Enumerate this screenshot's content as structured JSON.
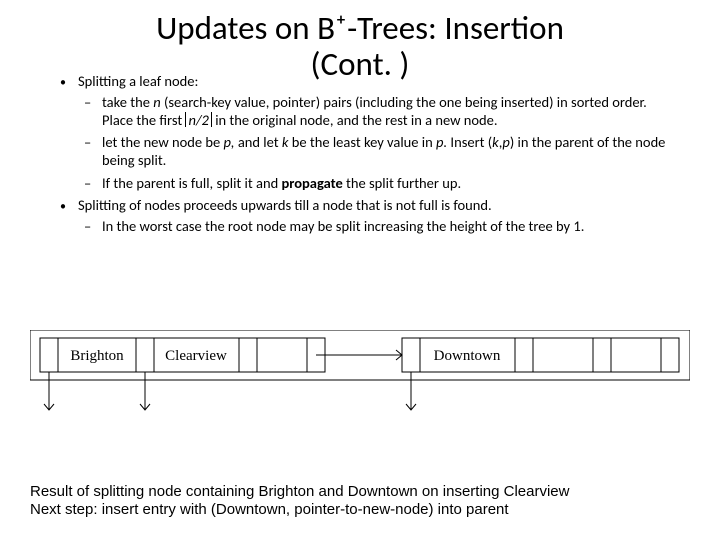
{
  "title_l1": "Updates on B⁺-Trees:  Insertion",
  "title_l2": "(Cont. )",
  "b1": "Splitting a leaf node:",
  "b1a_pre": "take the ",
  "b1a_n": "n",
  "b1a_mid": " (search-key value, pointer) pairs (including the one being inserted) in sorted order.  Place the first ",
  "b1a_ceil": "n/2",
  "b1a_post": " in the original node, and the rest in a new node.",
  "b1b_pre": "let the new node be ",
  "b1b_p": "p,",
  "b1b_mid1": " and let ",
  "b1b_k": "k",
  "b1b_mid2": " be the least key value in ",
  "b1b_p2": "p.",
  "b1b_mid3": "  Insert (",
  "b1b_k2": "k",
  "b1b_comma": ",",
  "b1b_p3": "p",
  "b1b_post": ") in the parent of the node being split.",
  "b1c_pre": "If the parent is full, split it and ",
  "b1c_bold": "propagate",
  "b1c_post": " the split further up.",
  "b2": "Splitting of nodes proceeds upwards till a node that is not full is found.",
  "b2a": "In the worst case the root node may be split increasing the height of the tree by 1.",
  "diagram": {
    "cells": [
      "Brighton",
      "Clearview",
      "",
      "Downtown",
      ""
    ]
  },
  "caption_l1": "Result of splitting node containing Brighton and Downtown on inserting Clearview",
  "caption_l2": "Next step: insert entry with (Downtown, pointer-to-new-node) into parent"
}
